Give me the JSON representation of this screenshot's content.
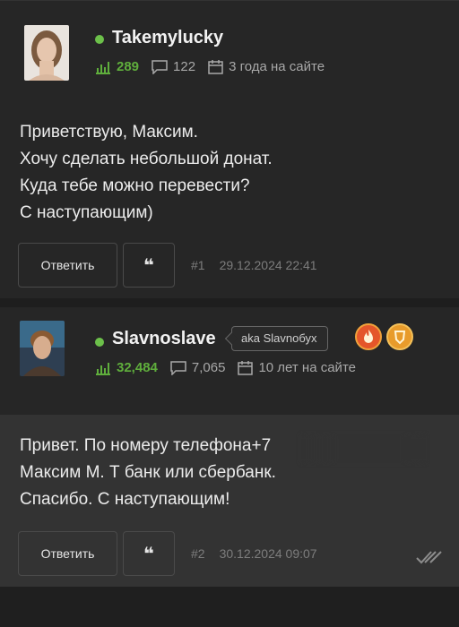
{
  "posts": [
    {
      "username": "Takemylucky",
      "rating": "289",
      "messages_count": "122",
      "tenure": "3 года на сайте",
      "message_lines": [
        "Приветствую, Максим.",
        "Хочу сделать небольшой донат.",
        "Куда тебе можно перевести?",
        "С наступающим)"
      ],
      "reply_label": "Ответить",
      "quote_label": "❝",
      "post_number": "#1",
      "date": "29.12.2024 22:41"
    },
    {
      "username": "Slavnoslave",
      "aka": "aka Slavnобух",
      "rating": "32,484",
      "messages_count": "7,065",
      "tenure": "10 лет на сайте",
      "message_lines": [
        "Привет. По номеру телефона+7",
        "Максим М. Т банк или сбербанк.",
        "Спасибо. С наступающим!"
      ],
      "reply_label": "Ответить",
      "quote_label": "❝",
      "post_number": "#2",
      "date": "30.12.2024 09:07"
    }
  ],
  "colors": {
    "accent_green": "#5fae3c",
    "online": "#6cc04a",
    "badge_fire": "#e4562a",
    "badge_gold": "#e89b2b"
  },
  "icons": [
    "rating-icon",
    "comment-icon",
    "calendar-icon",
    "read-checkmark-icon",
    "fire-badge-icon",
    "gold-badge-icon"
  ]
}
